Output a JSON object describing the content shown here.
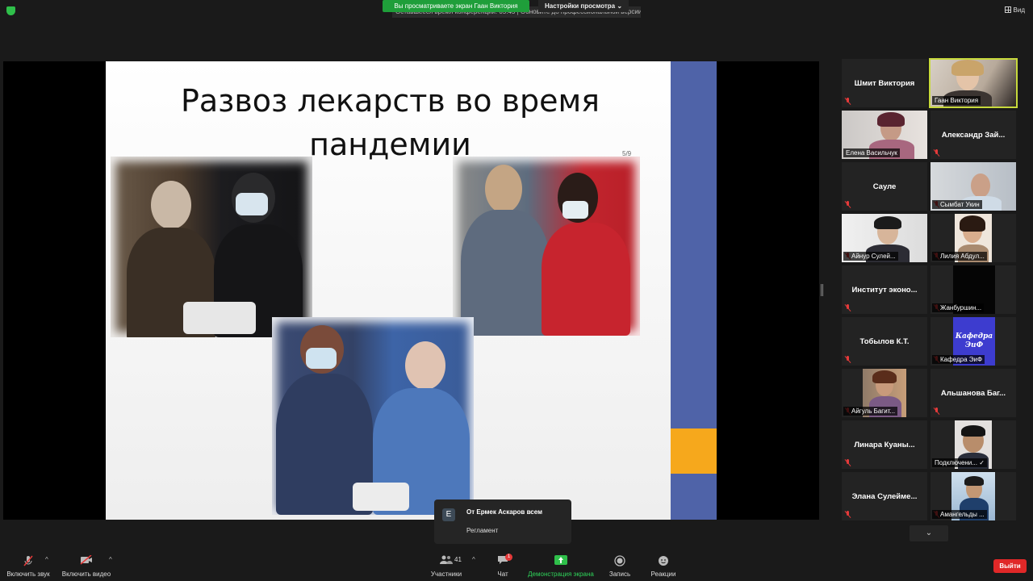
{
  "top": {
    "viewing_banner": "Вы просматриваете экран Гаан Виктория",
    "view_settings": "Настройки просмотра",
    "remaining_time": "Оставшееся время конференции: 05:45 | Обновите до профессиональной версии",
    "view_label": "Вид"
  },
  "slide": {
    "title": "Развоз лекарств во время пандемии",
    "page_indicator": "5/9",
    "colors": {
      "stripe_blue": "#4f63a8",
      "stripe_orange": "#f6a81c"
    }
  },
  "chat_toast": {
    "avatar_letter": "Е",
    "from": "От Ермек Аскаров всем",
    "message": "Регламент"
  },
  "participants": [
    {
      "name": "Шмит Виктория",
      "video": false,
      "muted": true
    },
    {
      "name": "Гаан Виктория",
      "video": true,
      "muted": false,
      "active": true
    },
    {
      "name": "Елена Васильчук",
      "video": true,
      "muted": false
    },
    {
      "name": "Александр Зай...",
      "video": false,
      "muted": true
    },
    {
      "name": "Сауле",
      "video": false,
      "muted": true
    },
    {
      "name": "Сымбат Укин",
      "video": true,
      "muted": true
    },
    {
      "name": "Айнур Сулей...",
      "video": true,
      "muted": true
    },
    {
      "name": "Лилия Абдул...",
      "video": true,
      "muted": true
    },
    {
      "name": "Институт эконо...",
      "video": false,
      "muted": true
    },
    {
      "name": "Жанбуршин...",
      "video": true,
      "muted": true
    },
    {
      "name": "Тобылов К.Т.",
      "video": false,
      "muted": true
    },
    {
      "name": "Кафедра ЭиФ",
      "video": true,
      "muted": true,
      "logo_text": "Кафедра ЭиФ"
    },
    {
      "name": "Айгуль Багит...",
      "video": true,
      "muted": true
    },
    {
      "name": "Альшанова Баг...",
      "video": false,
      "muted": true
    },
    {
      "name": "Линара Куаны...",
      "video": false,
      "muted": true
    },
    {
      "name": "Подключени...",
      "video": true,
      "muted": false
    },
    {
      "name": "Элана Сулейме...",
      "video": false,
      "muted": true
    },
    {
      "name": "Амангельды ...",
      "video": true,
      "muted": true
    }
  ],
  "toolbar": {
    "mute": "Включить звук",
    "video": "Включить видео",
    "participants": "Участники",
    "participants_count": "41",
    "chat": "Чат",
    "chat_badge": "1",
    "share": "Демонстрация экрана",
    "record": "Запись",
    "reactions": "Реакции",
    "end": "Выйти"
  },
  "icons": [
    "shield-icon",
    "grid-view-icon",
    "mic-off-icon",
    "video-off-icon",
    "participants-icon",
    "chat-icon",
    "share-screen-icon",
    "record-icon",
    "reactions-icon",
    "chevron-down-icon"
  ]
}
